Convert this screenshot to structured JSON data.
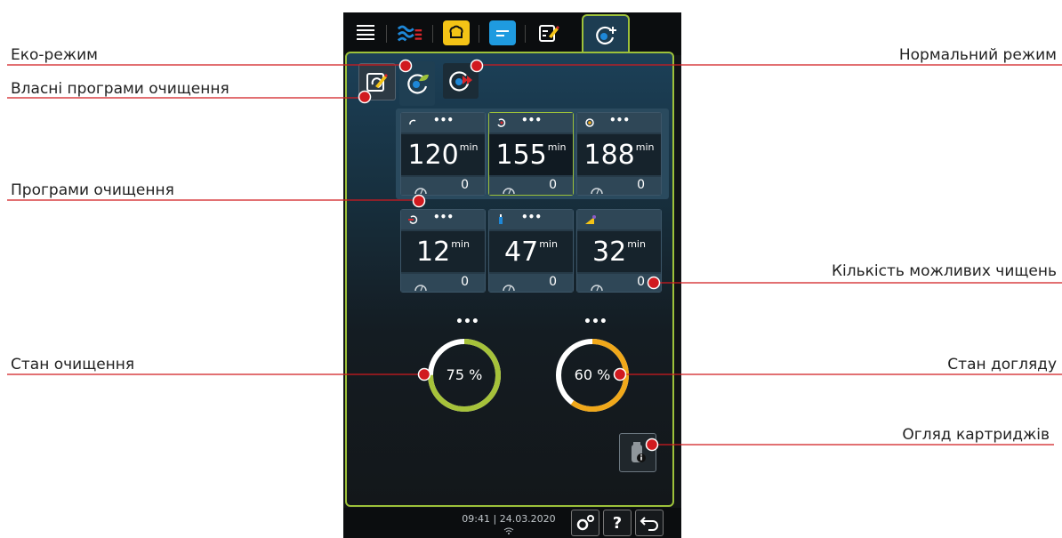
{
  "callouts": {
    "eco_mode": "Еко-режим",
    "own_programs": "Власні програми очищення",
    "cleaning_programs": "Програми очищення",
    "cleaning_state": "Стан очищення",
    "normal_mode": "Нормальний режим",
    "possible_cleanings": "Кількість можливих чищень",
    "care_state": "Стан догляду",
    "cartridge_overview": "Огляд картриджів"
  },
  "topbar": {
    "icons": [
      "menu-icon",
      "cooking-paths-icon",
      "chef-hat-icon",
      "card-list-icon",
      "edit-program-icon",
      "cleaning-icon"
    ],
    "active": "cleaning-icon"
  },
  "subtabs": [
    "own-programs-icon",
    "eco-cleaning-icon",
    "normal-cleaning-icon"
  ],
  "programs": [
    {
      "duration": "120",
      "unit": "min",
      "count": "0",
      "dots": "•••",
      "icon": "light-cleaning-icon",
      "selected": false
    },
    {
      "duration": "155",
      "unit": "min",
      "count": "0",
      "dots": "•••",
      "icon": "medium-cleaning-icon",
      "selected": true
    },
    {
      "duration": "188",
      "unit": "min",
      "count": "0",
      "dots": "•••",
      "icon": "strong-cleaning-icon",
      "selected": false
    },
    {
      "duration": "12",
      "unit": "min",
      "count": "0",
      "dots": "•••",
      "icon": "rinse-icon",
      "selected": false
    },
    {
      "duration": "47",
      "unit": "min",
      "count": "0",
      "dots": "•••",
      "icon": "express-cleaning-icon",
      "selected": false
    },
    {
      "duration": "32",
      "unit": "min",
      "count": "0",
      "dots": "",
      "icon": "descale-icon",
      "selected": false
    }
  ],
  "status": {
    "cleaning": {
      "label": "75 %",
      "value": 0.75,
      "color": "#a6c23a",
      "dots": "•••"
    },
    "care": {
      "label": "60 %",
      "value": 0.6,
      "color": "#f0a81a",
      "dots": "•••"
    }
  },
  "bottombar": {
    "datetime": "09:41 | 24.03.2020",
    "settings": "settings-icon",
    "help": "?",
    "back": "back-icon"
  },
  "colors": {
    "accent": "#9dc13a",
    "callout_line": "#d11a1f"
  }
}
